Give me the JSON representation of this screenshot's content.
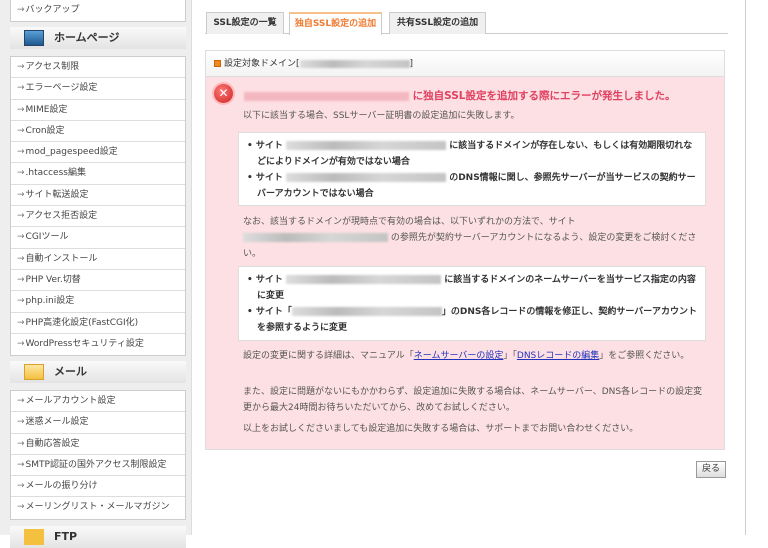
{
  "sidebar": {
    "backup": "バックアップ",
    "homepage": {
      "title": "ホームページ",
      "items": [
        "アクセス制限",
        "エラーページ設定",
        "MIME設定",
        "Cron設定",
        "mod_pagespeed設定",
        ".htaccess編集",
        "サイト転送設定",
        "アクセス拒否設定",
        "CGIツール",
        "自動インストール",
        "PHP Ver.切替",
        "php.ini設定",
        "PHP高速化設定(FastCGI化)",
        "WordPressセキュリティ設定"
      ]
    },
    "mail": {
      "title": "メール",
      "items": [
        "メールアカウント設定",
        "迷惑メール設定",
        "自動応答設定",
        "SMTP認証の国外アクセス制限設定",
        "メールの振り分け",
        "メーリングリスト・メールマガジン"
      ]
    },
    "ftp": {
      "title": "FTP"
    }
  },
  "tabs": [
    "SSL設定の一覧",
    "独自SSL設定の追加",
    "共有SSL設定の追加"
  ],
  "panel": {
    "header_prefix": "設定対象ドメイン[",
    "header_suffix": "]",
    "error_title": "に独自SSL設定を追加する際にエラーが発生しました。",
    "intro": "以下に該当する場合、SSLサーバー証明書の設定追加に失敗します。",
    "causes": [
      {
        "prefix": "サイト",
        "suffix": "に該当するドメインが存在しない、もしくは有効期限切れなどによりドメインが有効ではない場合"
      },
      {
        "prefix": "サイト",
        "suffix": "のDNS情報に関し、参照先サーバーが当サービスの契約サーバーアカウントではない場合"
      }
    ],
    "note_a": "なお、該当するドメインが現時点で有効の場合は、以下いずれかの方法で、サイト",
    "note_b": "の参照先が契約サーバーアカウントになるよう、設定の変更をご検討ください。",
    "fixes": [
      {
        "prefix": "サイト",
        "suffix": "に該当するドメインのネームサーバーを当サービス指定の内容に変更"
      },
      {
        "prefix": "サイト「",
        "suffix": "」のDNS各レコードの情報を修正し、契約サーバーアカウントを参照するように変更"
      }
    ],
    "manual_a": "設定の変更に関する詳細は、マニュアル「",
    "manual_link1": "ネームサーバーの設定",
    "manual_mid": "」「",
    "manual_link2": "DNSレコードの編集",
    "manual_b": "」をご参照ください。",
    "wait": "また、設定に問題がないにもかかわらず、設定追加に失敗する場合は、ネームサーバー、DNS各レコードの設定変更から最大24時間お待ちいただいてから、改めてお試しください。",
    "support": "以上をお試しくださいましても設定追加に失敗する場合は、サポートまでお問い合わせください。"
  },
  "back_label": "戻る",
  "colors": {
    "error_text": "#e04060",
    "error_bg": "#fde0e3",
    "active_tab": "#f07a30"
  }
}
